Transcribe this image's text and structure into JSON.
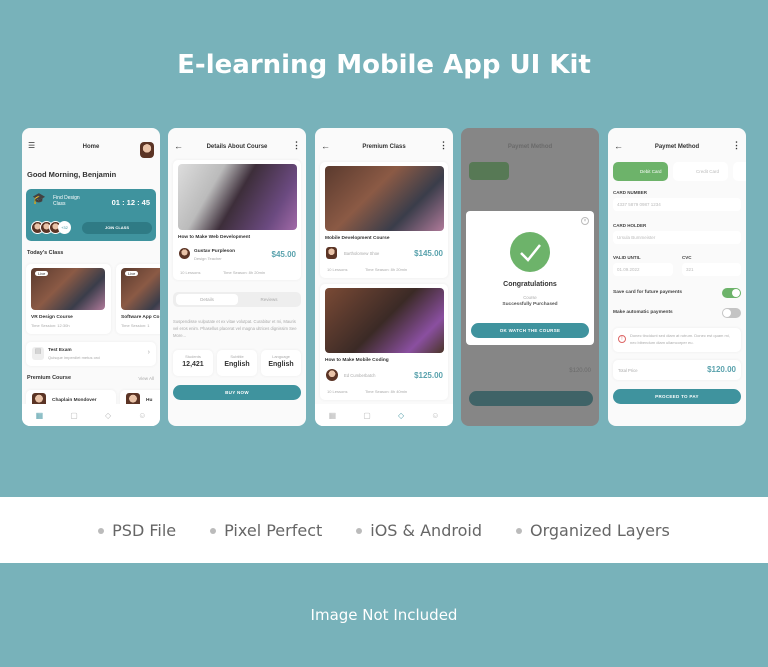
{
  "title": "E-learning Mobile App UI Kit",
  "features": [
    "PSD File",
    "Pixel Perfect",
    "iOS & Android",
    "Organized Layers"
  ],
  "footer": "Image Not Included",
  "colors": {
    "background": "#78b2ba",
    "accent": "#3f939e",
    "success": "#6db36a"
  },
  "home": {
    "title": "Home",
    "greeting": "Good Morning, Benjamin",
    "banner_title": "Find Design Class",
    "timer": "01 : 12 : 45",
    "extra_count": "+32",
    "join": "JOIN CLASS",
    "todays_class": "Today's Class",
    "live": "Live",
    "classes": [
      {
        "name": "VR Design Course",
        "time": "Time Session: 12:30h"
      },
      {
        "name": "Software App Co",
        "time": "Time Session: 1"
      }
    ],
    "exam_title": "Test Exam",
    "exam_sub": "Quisque imperdiet metus orci",
    "premium": "Premium Course",
    "view_all": "View All",
    "teacher": "Chaplain Mondover",
    "teacher2": "Hu"
  },
  "details": {
    "title": "Details About Course",
    "course": "How to Make Web Development",
    "teacher": "Gustav Purpleson",
    "role": "Design Teacher",
    "price": "$45.00",
    "lessons": "10 Lessons",
    "time": "Time Season: 8h 20min",
    "tabs": [
      "Details",
      "Reviews"
    ],
    "description": "Suspendisse vulputate et ex vitae volutpat. Curabitur et mi, Mauris vel eros enim. Phasellus placerat vel magna ultrices dignissim See More...",
    "stats": [
      {
        "label": "Students",
        "value": "12,421"
      },
      {
        "label": "Subtitle",
        "value": "English"
      },
      {
        "label": "Language",
        "value": "English"
      }
    ],
    "buy": "BUY NOW"
  },
  "premium": {
    "title": "Premium Class",
    "courses": [
      {
        "name": "Mobile Development Course",
        "teacher": "Bartholomew Shoe",
        "price": "$145.00",
        "lessons": "10 Lessons",
        "time": "Time Season: 8h 20min"
      },
      {
        "name": "How to Make Mobile Coding",
        "teacher": "Ed Cumberbatch",
        "price": "$125.00",
        "lessons": "10 Lessons",
        "time": "Time Season: 8h 40min"
      }
    ]
  },
  "success": {
    "bg_title": "Paymet Method",
    "heading": "Congratulations",
    "sub1": "Course",
    "sub2": "Successfully Purchased",
    "button": "OK WATCH THE COURSE",
    "bg_price": "$120.00"
  },
  "payment": {
    "title": "Paymet Method",
    "tabs": [
      "Debit Card",
      "Credit Card"
    ],
    "card_number_label": "CARD NUMBER",
    "card_number": "4337 5879 0987 1234",
    "holder_label": "CARD HOLDER",
    "holder": "Ursula Bummeister",
    "valid_label": "VALID UNTIL",
    "valid": "01.09.2022",
    "cvc_label": "CVC",
    "cvc": "321",
    "save_card": "Save card for future payments",
    "save_card_on": true,
    "auto": "Make automatic payments",
    "auto_on": false,
    "notice": "Donec tincidunt sed diam at rutrum. Donec est quam mi, nec bibendum diam ullamcorper eu.",
    "total_label": "Total Price",
    "total": "$120.00",
    "button": "PROCEED TO PAY"
  }
}
